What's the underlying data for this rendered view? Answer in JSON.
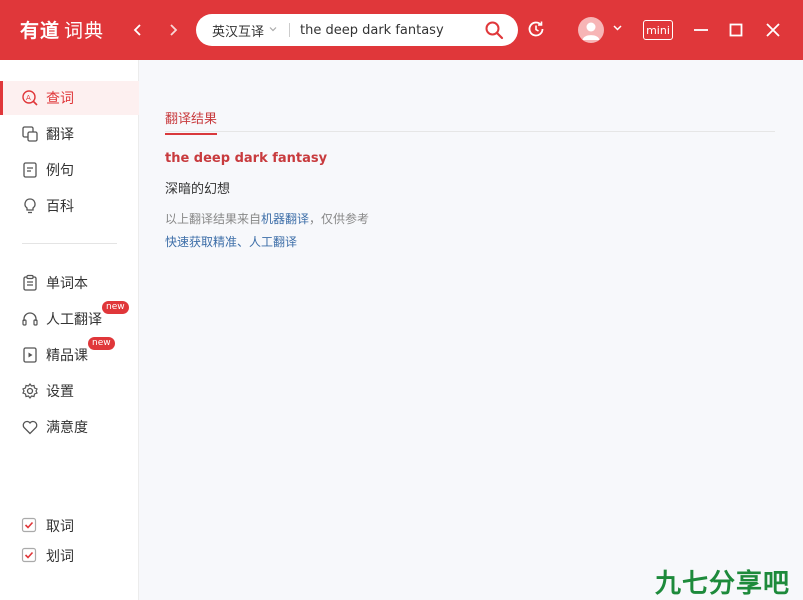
{
  "app": {
    "logo_main": "有道",
    "logo_sub": "词典"
  },
  "search": {
    "lang_mode": "英汉互译",
    "query": "the deep dark fantasy"
  },
  "toolbar": {
    "mini_label": "mini"
  },
  "sidebar": {
    "items": [
      {
        "label": "查词",
        "icon": "search-word-icon"
      },
      {
        "label": "翻译",
        "icon": "translate-icon"
      },
      {
        "label": "例句",
        "icon": "sentence-icon"
      },
      {
        "label": "百科",
        "icon": "bulb-icon"
      },
      {
        "label": "单词本",
        "icon": "wordbook-icon"
      },
      {
        "label": "人工翻译",
        "icon": "headset-icon",
        "badge": "new"
      },
      {
        "label": "精品课",
        "icon": "course-icon",
        "badge": "new"
      },
      {
        "label": "设置",
        "icon": "gear-icon"
      },
      {
        "label": "满意度",
        "icon": "heart-icon"
      }
    ],
    "toggles": [
      {
        "label": "取词",
        "checked": true
      },
      {
        "label": "划词",
        "checked": true
      }
    ]
  },
  "result": {
    "tab_title": "翻译结果",
    "query_word": "the deep dark fantasy",
    "translation": "深暗的幻想",
    "note_prefix": "以上翻译结果来自",
    "note_link": "机器翻译",
    "note_suffix": "，仅供参考",
    "human_link": "快速获取精准、人工翻译"
  },
  "watermark": "九七分享吧",
  "colors": {
    "accent": "#e0373a",
    "link": "#3d6ea8"
  }
}
